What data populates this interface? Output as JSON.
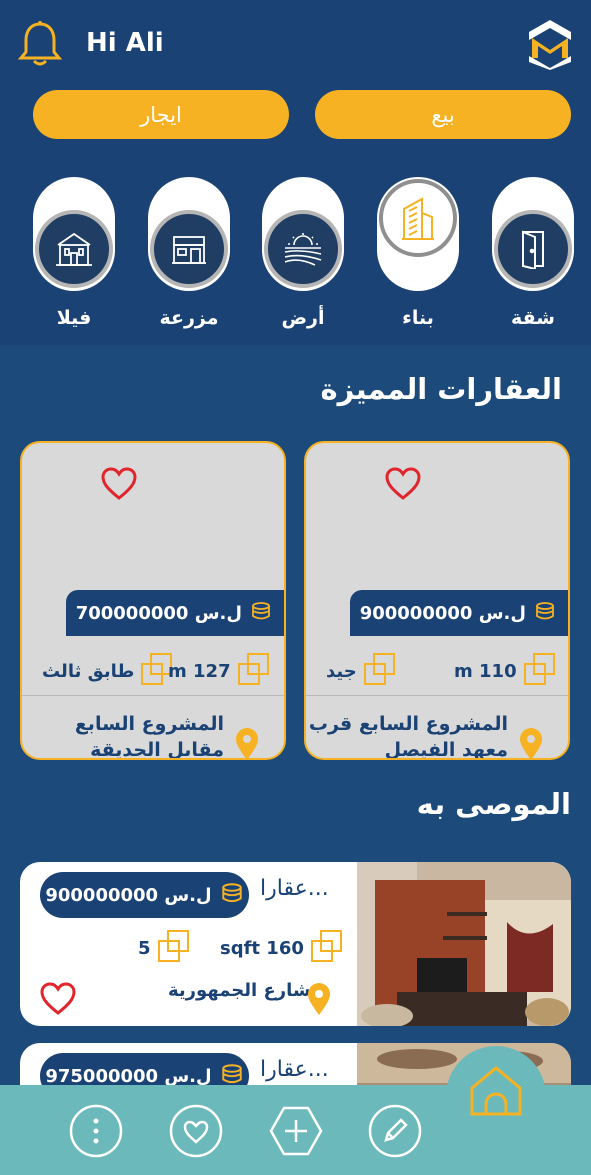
{
  "header": {
    "greeting": "Hi Ali"
  },
  "filters": {
    "rent_label": "ايجار",
    "sale_label": "بيع"
  },
  "categories": [
    {
      "label": "فيلا",
      "icon": "villa-icon"
    },
    {
      "label": "مزرعة",
      "icon": "farm-icon"
    },
    {
      "label": "أرض",
      "icon": "land-icon"
    },
    {
      "label": "بناء",
      "icon": "building-icon",
      "active": true
    },
    {
      "label": "شقة",
      "icon": "apartment-door-icon"
    }
  ],
  "featured": {
    "title": "العقارات المميزة",
    "cards": [
      {
        "price": "700000000 ل.س",
        "area": "m 127",
        "detail": "طابق ثالث",
        "address": "المشروع السابع مقابل الحديقة"
      },
      {
        "price": "900000000 ل.س",
        "area": "m 110",
        "detail": "جيد",
        "address": "المشروع السابع قرب معهد الفيصل"
      }
    ]
  },
  "recommended": {
    "title": "الموصى به",
    "items": [
      {
        "title": "عقارا...",
        "price": "900000000 ل.س",
        "rooms": "5",
        "area": "sqft 160",
        "street": "شارع الجمهورية"
      },
      {
        "title": "عقارا...",
        "price": "975000000 ل.س"
      }
    ]
  },
  "colors": {
    "primary": "#1b4274",
    "accent": "#f6b222",
    "nav": "#6cb9bb",
    "heart": "#e0262c"
  }
}
